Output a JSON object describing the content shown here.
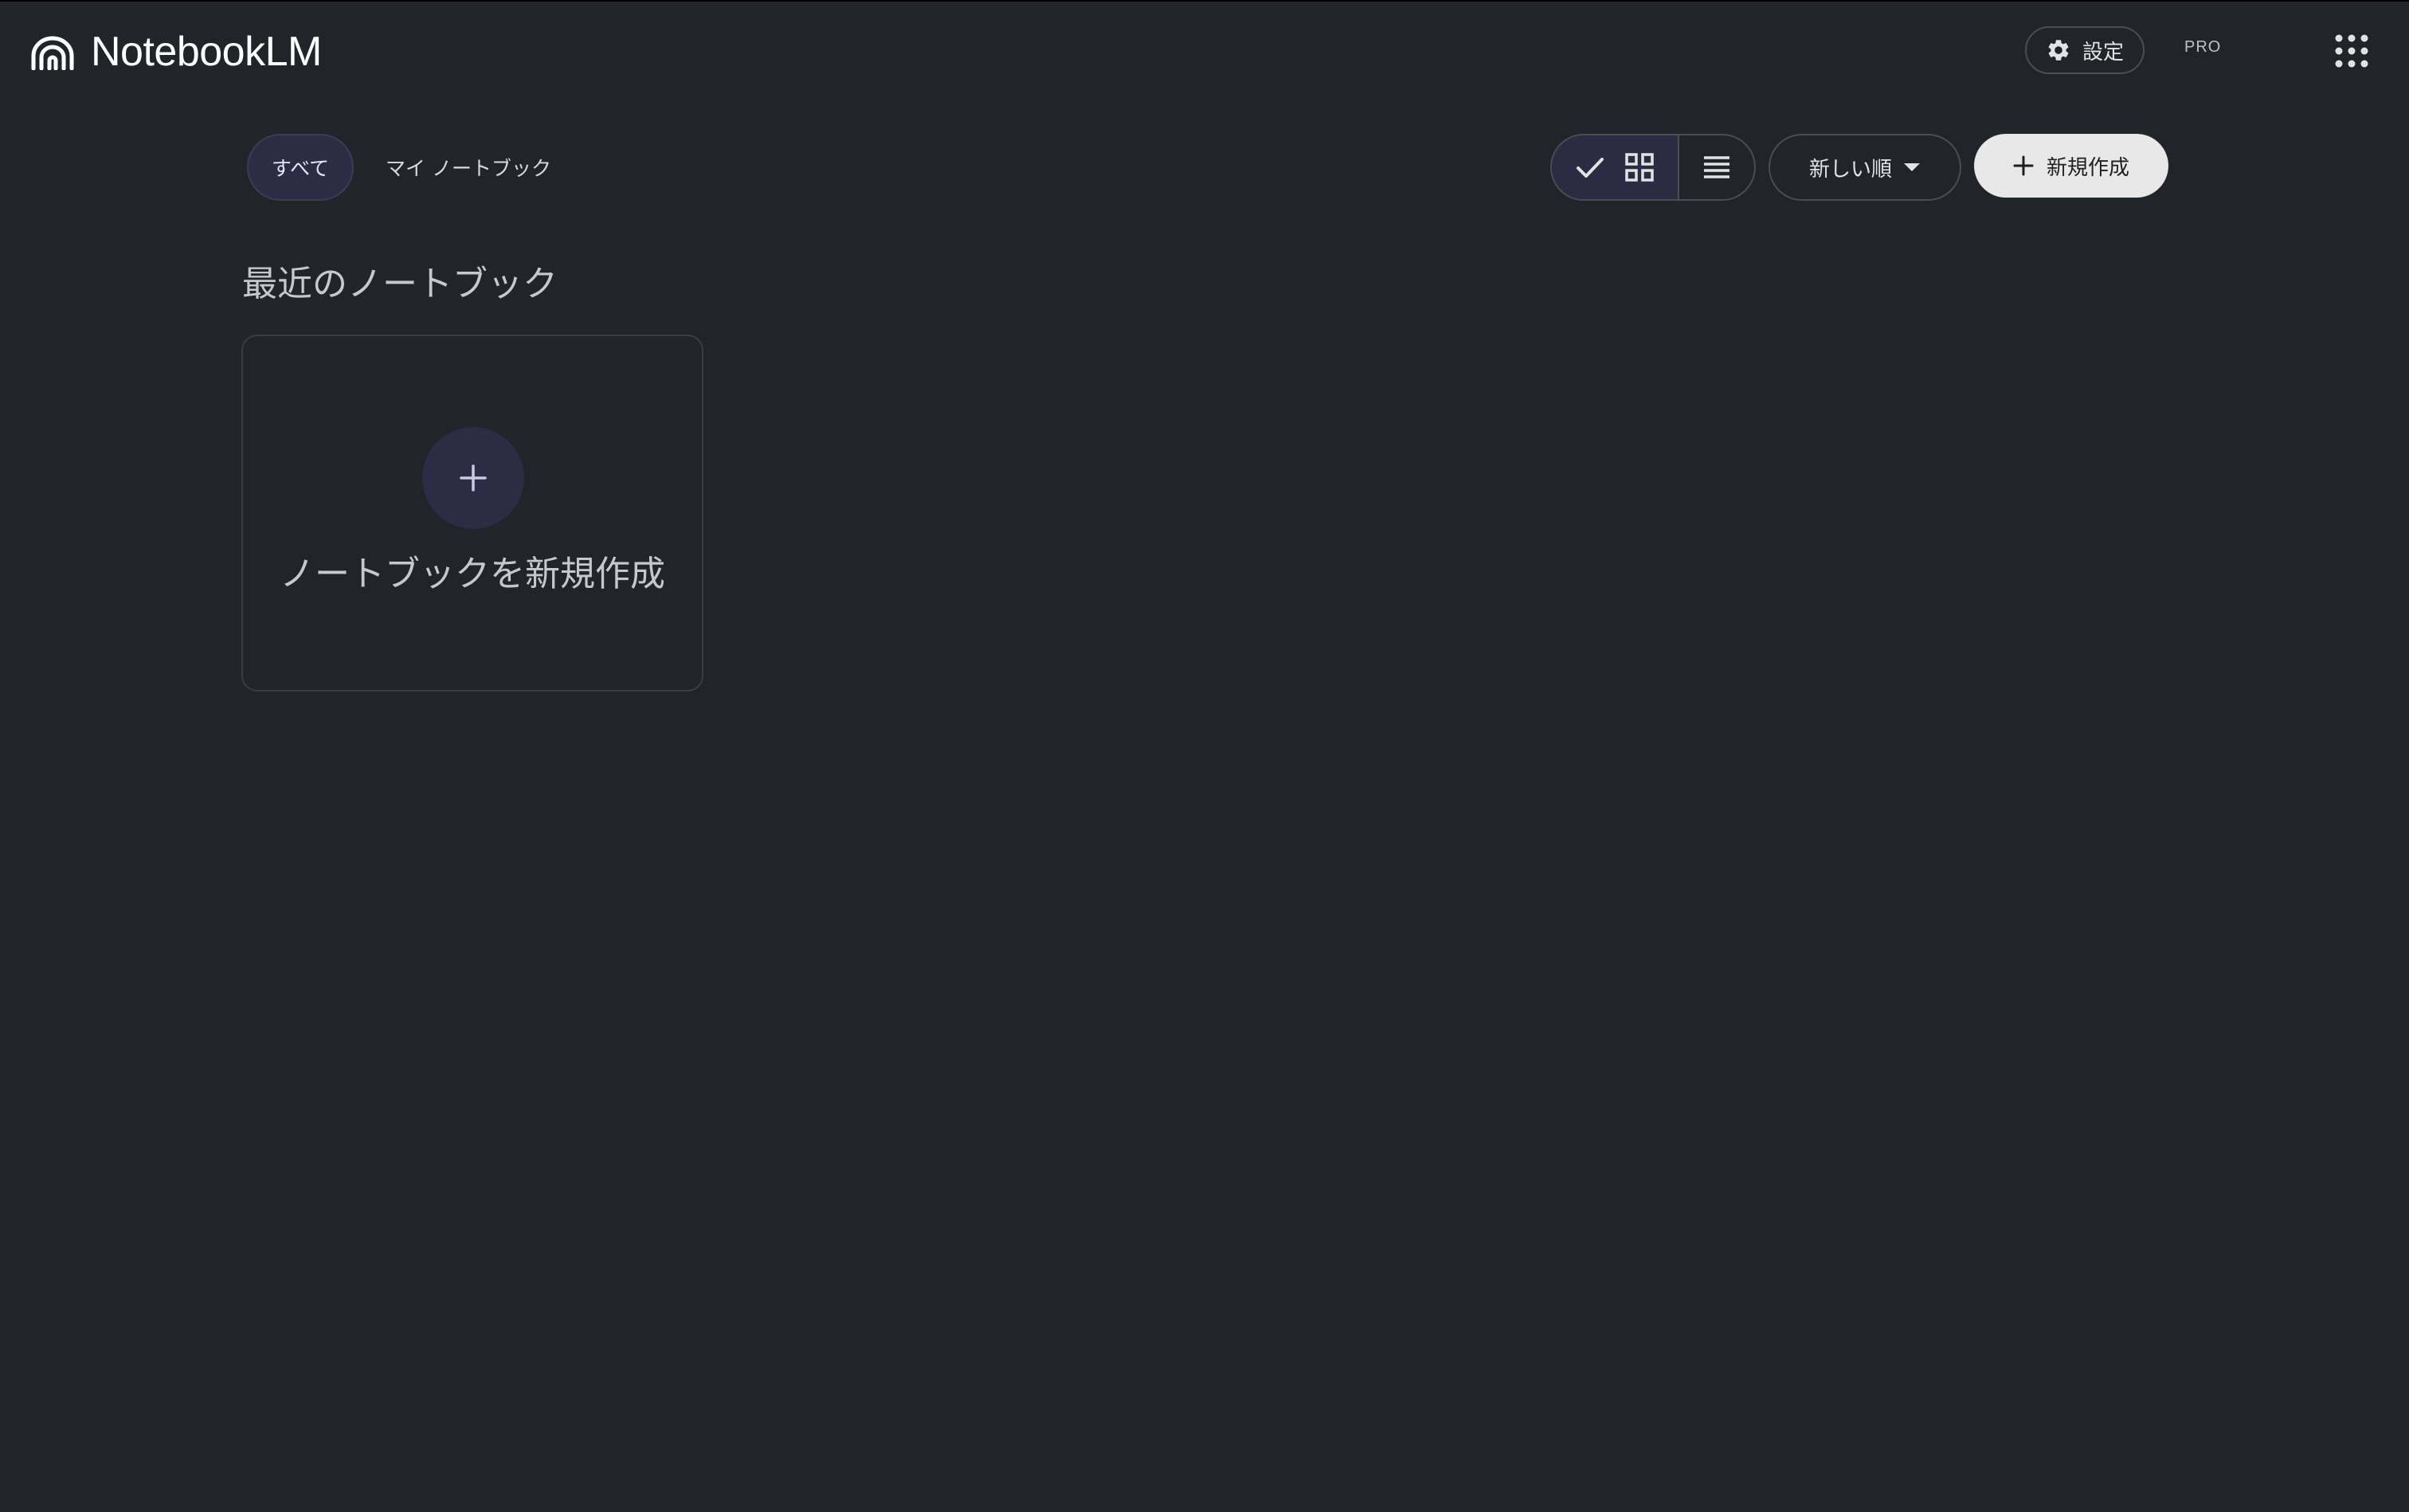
{
  "app": {
    "title": "NotebookLM",
    "pro_badge": "PRO"
  },
  "header": {
    "settings_label": "設定",
    "icons": [
      "notebooklm-logo-icon",
      "gear-icon",
      "apps-grid-icon"
    ]
  },
  "filters": {
    "all_label": "すべて",
    "mine_label": "マイ ノートブック",
    "selected": "すべて"
  },
  "toolbar": {
    "view_mode": "grid",
    "sort_label": "新しい順",
    "create_label": "新規作成"
  },
  "main": {
    "section_title": "最近のノートブック",
    "new_notebook_label": "ノートブックを新規作成"
  },
  "colors": {
    "background": "#212429",
    "chip_selected": "#2c2d44",
    "create_button": "#e8e8e8"
  }
}
